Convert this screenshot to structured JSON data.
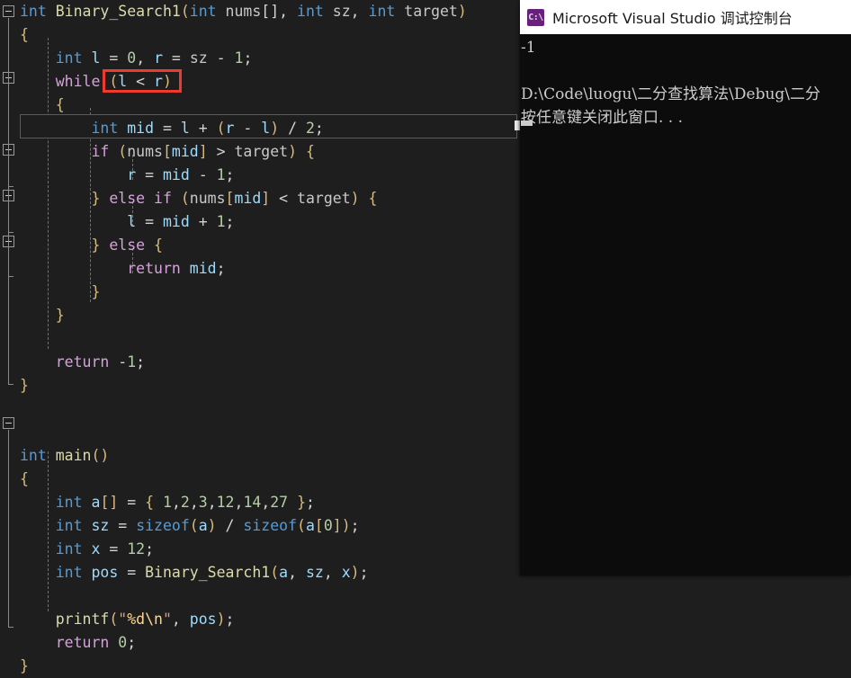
{
  "editor": {
    "background": "#1e1e1e",
    "current_line_number": 7,
    "annotation": {
      "type": "red-rectangle",
      "color": "#f03a2e",
      "targets_text": "(l < r)"
    },
    "code_lines": [
      {
        "indent": 0,
        "tokens": [
          {
            "t": "int",
            "c": "kw"
          },
          {
            "t": " ",
            "c": "pun"
          },
          {
            "t": "Binary_Search1",
            "c": "fn"
          },
          {
            "t": "(",
            "c": "br1"
          },
          {
            "t": "int",
            "c": "kw"
          },
          {
            "t": " ",
            "c": "pun"
          },
          {
            "t": "nums",
            "c": "param"
          },
          {
            "t": "[],",
            "c": "pun"
          },
          {
            "t": " ",
            "c": "pun"
          },
          {
            "t": "int",
            "c": "kw"
          },
          {
            "t": " ",
            "c": "pun"
          },
          {
            "t": "sz",
            "c": "param"
          },
          {
            "t": ",",
            "c": "pun"
          },
          {
            "t": " ",
            "c": "pun"
          },
          {
            "t": "int",
            "c": "kw"
          },
          {
            "t": " ",
            "c": "pun"
          },
          {
            "t": "target",
            "c": "param"
          },
          {
            "t": ")",
            "c": "br1"
          }
        ]
      },
      {
        "indent": 0,
        "tokens": [
          {
            "t": "{",
            "c": "br1"
          }
        ]
      },
      {
        "indent": 0,
        "tokens": [
          {
            "t": "    ",
            "c": "pun"
          },
          {
            "t": "int",
            "c": "kw"
          },
          {
            "t": " ",
            "c": "pun"
          },
          {
            "t": "l",
            "c": "loc"
          },
          {
            "t": " = ",
            "c": "pun"
          },
          {
            "t": "0",
            "c": "num"
          },
          {
            "t": ", ",
            "c": "pun"
          },
          {
            "t": "r",
            "c": "loc"
          },
          {
            "t": " = ",
            "c": "pun"
          },
          {
            "t": "sz",
            "c": "param"
          },
          {
            "t": " - ",
            "c": "pun"
          },
          {
            "t": "1",
            "c": "num"
          },
          {
            "t": ";",
            "c": "pun"
          }
        ]
      },
      {
        "indent": 0,
        "tokens": [
          {
            "t": "    ",
            "c": "pun"
          },
          {
            "t": "while",
            "c": "ctl"
          },
          {
            "t": " ",
            "c": "pun"
          },
          {
            "t": "(",
            "c": "br1"
          },
          {
            "t": "l",
            "c": "loc"
          },
          {
            "t": " < ",
            "c": "pun"
          },
          {
            "t": "r",
            "c": "loc"
          },
          {
            "t": ")",
            "c": "br1"
          }
        ]
      },
      {
        "indent": 0,
        "tokens": [
          {
            "t": "    ",
            "c": "pun"
          },
          {
            "t": "{",
            "c": "br1"
          }
        ]
      },
      {
        "indent": 0,
        "tokens": [
          {
            "t": "        ",
            "c": "pun"
          },
          {
            "t": "int",
            "c": "kw"
          },
          {
            "t": " ",
            "c": "pun"
          },
          {
            "t": "mid",
            "c": "loc"
          },
          {
            "t": " = ",
            "c": "pun"
          },
          {
            "t": "l",
            "c": "loc"
          },
          {
            "t": " + ",
            "c": "pun"
          },
          {
            "t": "(",
            "c": "br1"
          },
          {
            "t": "r",
            "c": "loc"
          },
          {
            "t": " - ",
            "c": "pun"
          },
          {
            "t": "l",
            "c": "loc"
          },
          {
            "t": ")",
            "c": "br1"
          },
          {
            "t": " / ",
            "c": "pun"
          },
          {
            "t": "2",
            "c": "num"
          },
          {
            "t": ";",
            "c": "pun"
          }
        ]
      },
      {
        "indent": 0,
        "tokens": [
          {
            "t": "        ",
            "c": "pun"
          },
          {
            "t": "if",
            "c": "ctl"
          },
          {
            "t": " ",
            "c": "pun"
          },
          {
            "t": "(",
            "c": "br1"
          },
          {
            "t": "nums",
            "c": "param"
          },
          {
            "t": "[",
            "c": "br1"
          },
          {
            "t": "mid",
            "c": "loc"
          },
          {
            "t": "]",
            "c": "br1"
          },
          {
            "t": " > ",
            "c": "pun"
          },
          {
            "t": "target",
            "c": "param"
          },
          {
            "t": ")",
            "c": "br1"
          },
          {
            "t": " ",
            "c": "pun"
          },
          {
            "t": "{",
            "c": "br1"
          }
        ]
      },
      {
        "indent": 0,
        "tokens": [
          {
            "t": "            ",
            "c": "pun"
          },
          {
            "t": "r",
            "c": "loc"
          },
          {
            "t": " = ",
            "c": "pun"
          },
          {
            "t": "mid",
            "c": "loc"
          },
          {
            "t": " - ",
            "c": "pun"
          },
          {
            "t": "1",
            "c": "num"
          },
          {
            "t": ";",
            "c": "pun"
          }
        ]
      },
      {
        "indent": 0,
        "tokens": [
          {
            "t": "        ",
            "c": "pun"
          },
          {
            "t": "}",
            "c": "br1"
          },
          {
            "t": " ",
            "c": "pun"
          },
          {
            "t": "else",
            "c": "ctl"
          },
          {
            "t": " ",
            "c": "pun"
          },
          {
            "t": "if",
            "c": "ctl"
          },
          {
            "t": " ",
            "c": "pun"
          },
          {
            "t": "(",
            "c": "br1"
          },
          {
            "t": "nums",
            "c": "param"
          },
          {
            "t": "[",
            "c": "br1"
          },
          {
            "t": "mid",
            "c": "loc"
          },
          {
            "t": "]",
            "c": "br1"
          },
          {
            "t": " < ",
            "c": "pun"
          },
          {
            "t": "target",
            "c": "param"
          },
          {
            "t": ")",
            "c": "br1"
          },
          {
            "t": " ",
            "c": "pun"
          },
          {
            "t": "{",
            "c": "br1"
          }
        ]
      },
      {
        "indent": 0,
        "tokens": [
          {
            "t": "            ",
            "c": "pun"
          },
          {
            "t": "l",
            "c": "loc"
          },
          {
            "t": " = ",
            "c": "pun"
          },
          {
            "t": "mid",
            "c": "loc"
          },
          {
            "t": " + ",
            "c": "pun"
          },
          {
            "t": "1",
            "c": "num"
          },
          {
            "t": ";",
            "c": "pun"
          }
        ]
      },
      {
        "indent": 0,
        "tokens": [
          {
            "t": "        ",
            "c": "pun"
          },
          {
            "t": "}",
            "c": "br1"
          },
          {
            "t": " ",
            "c": "pun"
          },
          {
            "t": "else",
            "c": "ctl"
          },
          {
            "t": " ",
            "c": "pun"
          },
          {
            "t": "{",
            "c": "br1"
          }
        ]
      },
      {
        "indent": 0,
        "tokens": [
          {
            "t": "            ",
            "c": "pun"
          },
          {
            "t": "return",
            "c": "ctl"
          },
          {
            "t": " ",
            "c": "pun"
          },
          {
            "t": "mid",
            "c": "loc"
          },
          {
            "t": ";",
            "c": "pun"
          }
        ]
      },
      {
        "indent": 0,
        "tokens": [
          {
            "t": "        ",
            "c": "pun"
          },
          {
            "t": "}",
            "c": "br1"
          }
        ]
      },
      {
        "indent": 0,
        "tokens": [
          {
            "t": "    ",
            "c": "pun"
          },
          {
            "t": "}",
            "c": "br1"
          }
        ]
      },
      {
        "indent": 0,
        "tokens": []
      },
      {
        "indent": 0,
        "tokens": [
          {
            "t": "    ",
            "c": "pun"
          },
          {
            "t": "return",
            "c": "ctl"
          },
          {
            "t": " ",
            "c": "pun"
          },
          {
            "t": "-",
            "c": "pun"
          },
          {
            "t": "1",
            "c": "num"
          },
          {
            "t": ";",
            "c": "pun"
          }
        ]
      },
      {
        "indent": 0,
        "tokens": [
          {
            "t": "}",
            "c": "br1"
          }
        ]
      },
      {
        "indent": 0,
        "tokens": []
      },
      {
        "indent": 0,
        "tokens": []
      },
      {
        "indent": 0,
        "tokens": [
          {
            "t": "int",
            "c": "kw"
          },
          {
            "t": " ",
            "c": "pun"
          },
          {
            "t": "main",
            "c": "fn"
          },
          {
            "t": "()",
            "c": "br1"
          }
        ]
      },
      {
        "indent": 0,
        "tokens": [
          {
            "t": "{",
            "c": "br1"
          }
        ]
      },
      {
        "indent": 0,
        "tokens": [
          {
            "t": "    ",
            "c": "pun"
          },
          {
            "t": "int",
            "c": "kw"
          },
          {
            "t": " ",
            "c": "pun"
          },
          {
            "t": "a",
            "c": "loc"
          },
          {
            "t": "[]",
            "c": "br1"
          },
          {
            "t": " = ",
            "c": "pun"
          },
          {
            "t": "{",
            "c": "br1"
          },
          {
            "t": " ",
            "c": "pun"
          },
          {
            "t": "1",
            "c": "num"
          },
          {
            "t": ",",
            "c": "pun"
          },
          {
            "t": "2",
            "c": "num"
          },
          {
            "t": ",",
            "c": "pun"
          },
          {
            "t": "3",
            "c": "num"
          },
          {
            "t": ",",
            "c": "pun"
          },
          {
            "t": "12",
            "c": "num"
          },
          {
            "t": ",",
            "c": "pun"
          },
          {
            "t": "14",
            "c": "num"
          },
          {
            "t": ",",
            "c": "pun"
          },
          {
            "t": "27",
            "c": "num"
          },
          {
            "t": " ",
            "c": "pun"
          },
          {
            "t": "}",
            "c": "br1"
          },
          {
            "t": ";",
            "c": "pun"
          }
        ]
      },
      {
        "indent": 0,
        "tokens": [
          {
            "t": "    ",
            "c": "pun"
          },
          {
            "t": "int",
            "c": "kw"
          },
          {
            "t": " ",
            "c": "pun"
          },
          {
            "t": "sz",
            "c": "loc"
          },
          {
            "t": " = ",
            "c": "pun"
          },
          {
            "t": "sizeof",
            "c": "kw"
          },
          {
            "t": "(",
            "c": "br1"
          },
          {
            "t": "a",
            "c": "loc"
          },
          {
            "t": ")",
            "c": "br1"
          },
          {
            "t": " / ",
            "c": "pun"
          },
          {
            "t": "sizeof",
            "c": "kw"
          },
          {
            "t": "(",
            "c": "br1"
          },
          {
            "t": "a",
            "c": "loc"
          },
          {
            "t": "[",
            "c": "br1"
          },
          {
            "t": "0",
            "c": "num"
          },
          {
            "t": "]",
            "c": "br1"
          },
          {
            "t": ")",
            "c": "br1"
          },
          {
            "t": ";",
            "c": "pun"
          }
        ]
      },
      {
        "indent": 0,
        "tokens": [
          {
            "t": "    ",
            "c": "pun"
          },
          {
            "t": "int",
            "c": "kw"
          },
          {
            "t": " ",
            "c": "pun"
          },
          {
            "t": "x",
            "c": "loc"
          },
          {
            "t": " = ",
            "c": "pun"
          },
          {
            "t": "12",
            "c": "num"
          },
          {
            "t": ";",
            "c": "pun"
          }
        ]
      },
      {
        "indent": 0,
        "tokens": [
          {
            "t": "    ",
            "c": "pun"
          },
          {
            "t": "int",
            "c": "kw"
          },
          {
            "t": " ",
            "c": "pun"
          },
          {
            "t": "pos",
            "c": "loc"
          },
          {
            "t": " = ",
            "c": "pun"
          },
          {
            "t": "Binary_Search1",
            "c": "fn"
          },
          {
            "t": "(",
            "c": "br1"
          },
          {
            "t": "a",
            "c": "loc"
          },
          {
            "t": ", ",
            "c": "pun"
          },
          {
            "t": "sz",
            "c": "loc"
          },
          {
            "t": ", ",
            "c": "pun"
          },
          {
            "t": "x",
            "c": "loc"
          },
          {
            "t": ")",
            "c": "br1"
          },
          {
            "t": ";",
            "c": "pun"
          }
        ]
      },
      {
        "indent": 0,
        "tokens": []
      },
      {
        "indent": 0,
        "tokens": [
          {
            "t": "    ",
            "c": "pun"
          },
          {
            "t": "printf",
            "c": "fn"
          },
          {
            "t": "(",
            "c": "br1"
          },
          {
            "t": "\"",
            "c": "str"
          },
          {
            "t": "%d",
            "c": "esc"
          },
          {
            "t": "\\n",
            "c": "esc"
          },
          {
            "t": "\"",
            "c": "str"
          },
          {
            "t": ", ",
            "c": "pun"
          },
          {
            "t": "pos",
            "c": "loc"
          },
          {
            "t": ")",
            "c": "br1"
          },
          {
            "t": ";",
            "c": "pun"
          }
        ]
      },
      {
        "indent": 0,
        "tokens": [
          {
            "t": "    ",
            "c": "pun"
          },
          {
            "t": "return",
            "c": "ctl"
          },
          {
            "t": " ",
            "c": "pun"
          },
          {
            "t": "0",
            "c": "num"
          },
          {
            "t": ";",
            "c": "pun"
          }
        ]
      },
      {
        "indent": 0,
        "tokens": [
          {
            "t": "}",
            "c": "br1"
          }
        ]
      }
    ]
  },
  "console": {
    "title": "Microsoft Visual Studio 调试控制台",
    "icon": "console-app-icon",
    "icon_glyph": "C:\\",
    "icon_color": "#68217a",
    "background": "#0c0c0c",
    "text_color": "#cccccc",
    "lines": [
      "-1",
      "",
      "D:\\Code\\luogu\\二分查找算法\\Debug\\二分",
      "按任意键关闭此窗口. . ."
    ]
  }
}
